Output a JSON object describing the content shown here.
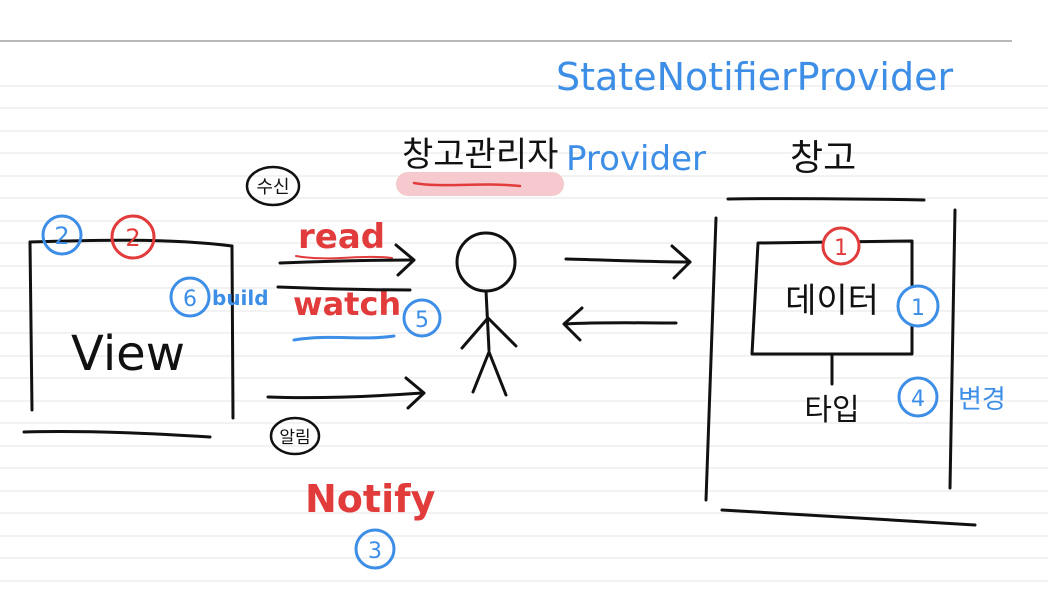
{
  "colors": {
    "ink": "#111111",
    "red": "#e23b3b",
    "blue": "#3d8ee6",
    "highlight": "#f6c9cf",
    "rule": "#e6e6e6",
    "top_rule": "#b9b9b9"
  },
  "view": {
    "label": "View",
    "badge_blue": "2",
    "badge_red": "2"
  },
  "left_arrows": {
    "top_circle": "수신",
    "read": "read",
    "watch": "watch",
    "build_number": "6",
    "build": "build",
    "watch_number": "5",
    "bottom_circle": "알림",
    "notify": "Notify",
    "notify_number": "3"
  },
  "manager": {
    "title": "창고관리자",
    "provider": "Provider",
    "state_notifier_provider": "StateNotifierProvider"
  },
  "warehouse": {
    "title": "창고",
    "data_label": "데이터",
    "data_number_red": "1",
    "data_number_blue": "1",
    "type_label": "타입",
    "change_number": "4",
    "change_label": "변경"
  }
}
